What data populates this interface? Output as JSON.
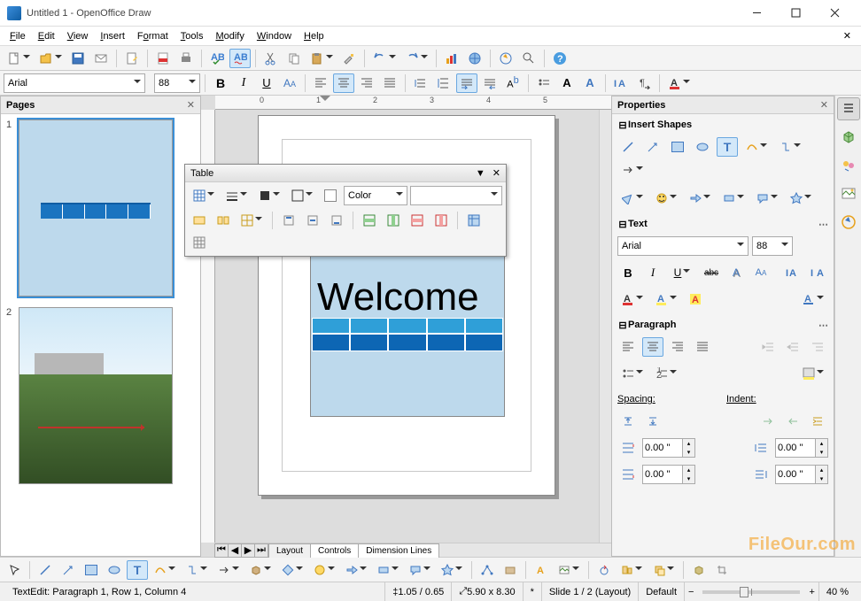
{
  "titlebar": {
    "title": "Untitled 1 - OpenOffice Draw"
  },
  "menubar": [
    "File",
    "Edit",
    "View",
    "Insert",
    "Format",
    "Tools",
    "Modify",
    "Window",
    "Help"
  ],
  "standard_toolbar": {
    "items": [
      "new",
      "open",
      "save",
      "mail",
      "edit-doc",
      "pdf",
      "print-direct",
      "print",
      "spellcheck",
      "autospell",
      "cut",
      "copy",
      "paste",
      "format-paintbrush",
      "undo",
      "redo",
      "chart",
      "hyperlink",
      "navigator",
      "zoom",
      "help"
    ]
  },
  "format_toolbar": {
    "font_name": "Arial",
    "font_size": "88",
    "items": [
      "bold",
      "italic",
      "underline",
      "doubleletter",
      "align-left",
      "align-center",
      "align-right",
      "align-justify",
      "linespace-1",
      "linespace-15",
      "para-ltr",
      "para-rtl",
      "super",
      "bullets",
      "numbering",
      "increase-indent",
      "decrease-indent",
      "char-color",
      "highlight"
    ]
  },
  "pages_panel": {
    "title": "Pages",
    "pages": [
      {
        "num": 1
      },
      {
        "num": 2
      }
    ]
  },
  "canvas": {
    "text": "Welcome",
    "tabs": [
      "Layout",
      "Controls",
      "Dimension Lines"
    ]
  },
  "table_toolbar": {
    "title": "Table",
    "color_label": "Color",
    "row1": [
      "table",
      "line-style",
      "line-color",
      "border",
      "fill-color-box",
      "fill-pick"
    ],
    "row2": [
      "merge",
      "split",
      "optimize",
      "align-top",
      "align-mid",
      "align-bottom",
      "insert-row",
      "insert-col",
      "delete-row",
      "delete-col",
      "autoformat",
      "table-props",
      "sum"
    ]
  },
  "properties": {
    "title": "Properties",
    "insert_shapes": {
      "title": "Insert Shapes",
      "row1": [
        "line",
        "arrow",
        "rect",
        "ellipse",
        "text",
        "curve",
        "connector",
        "lines-more"
      ],
      "row2": [
        "basic-shapes",
        "symbol",
        "block-arrows",
        "flowchart",
        "callouts",
        "stars"
      ]
    },
    "text": {
      "title": "Text",
      "font_name": "Arial",
      "font_size": "88",
      "style_row": [
        "bold",
        "italic",
        "underline",
        "strike",
        "shadow",
        "contour"
      ],
      "effects_row_right": [
        "increase",
        "decrease"
      ],
      "color_row": [
        "font-color-a",
        "char-a",
        "highlight-a"
      ],
      "spacing_row": [
        "char-spacing"
      ],
      "sup_sub": [
        "super",
        "sub"
      ]
    },
    "paragraph": {
      "title": "Paragraph",
      "align": [
        "left",
        "center",
        "right",
        "justify"
      ],
      "indent_btns": [
        "inc-indent",
        "dec-indent",
        "hanging"
      ],
      "list_btns": [
        "bullets",
        "numbering"
      ],
      "bg": "para-bg",
      "spacing_label": "Spacing:",
      "indent_label": "Indent:",
      "spacing_btns": [
        "space-inc",
        "space-dec"
      ],
      "indent_arrows": [
        "indent-left",
        "indent-right",
        "indent-first"
      ],
      "above": "0.00 \"",
      "below": "0.00 \"",
      "left": "0.00 \"",
      "right": "0.00 \""
    }
  },
  "bottom_toolbar": {
    "items": [
      "pointer",
      "line",
      "arrow",
      "rect",
      "ellipse",
      "text",
      "curve",
      "connector",
      "lines",
      "basic",
      "symbols",
      "block-arrows",
      "flowchart",
      "callouts",
      "stars",
      "points",
      "glue",
      "fontwork",
      "from-file",
      "gallery",
      "effects",
      "align",
      "arrange",
      "extrusion",
      "crop"
    ]
  },
  "statusbar": {
    "context": "TextEdit: Paragraph 1, Row 1, Column 4",
    "pos": "1.05 / 0.65",
    "size": "5.90 x 8.30",
    "modified": "*",
    "slide": "Slide 1 / 2 (Layout)",
    "layer": "Default",
    "zoom": "40 %"
  },
  "watermark": "FileOur.com"
}
